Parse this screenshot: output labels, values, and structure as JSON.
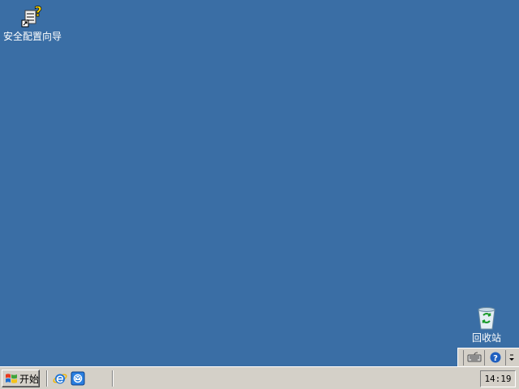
{
  "desktop": {
    "icons": [
      {
        "label": "安全配置向导",
        "icon": "security-wizard-icon"
      },
      {
        "label": "回收站",
        "icon": "recycle-bin-icon"
      }
    ]
  },
  "taskbar": {
    "start_label": "开始",
    "quick_launch": [
      {
        "icon": "internet-explorer-icon"
      },
      {
        "icon": "outlook-express-icon"
      }
    ],
    "clock": "14:19"
  },
  "language_bar": {
    "buttons": [
      "keyboard-icon",
      "help-icon",
      "options-arrow-icon"
    ],
    "help_glyph": "?"
  },
  "colors": {
    "desktop_bg": "#3a6ea5",
    "taskbar_bg": "#d4d0c8"
  }
}
